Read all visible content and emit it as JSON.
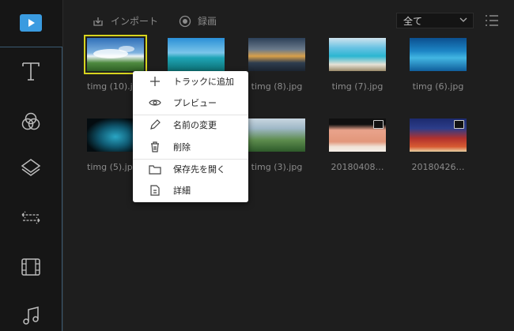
{
  "toolbar": {
    "import_label": "インポート",
    "record_label": "録画",
    "filter_value": "全て"
  },
  "sidebar": {
    "items": [
      {
        "icon": "media-icon"
      },
      {
        "icon": "text-icon"
      },
      {
        "icon": "filters-icon"
      },
      {
        "icon": "overlays-icon"
      },
      {
        "icon": "transitions-icon"
      },
      {
        "icon": "elements-icon"
      },
      {
        "icon": "music-icon"
      }
    ]
  },
  "media": {
    "row1": [
      {
        "label": "timg (10).jpg",
        "selected": true,
        "video": false
      },
      {
        "label": "",
        "selected": false,
        "video": false
      },
      {
        "label": "timg (8).jpg",
        "selected": false,
        "video": false
      },
      {
        "label": "timg (7).jpg",
        "selected": false,
        "video": false
      },
      {
        "label": "timg (6).jpg",
        "selected": false,
        "video": false
      }
    ],
    "row2": [
      {
        "label": "timg (5).jpg",
        "selected": false,
        "video": false
      },
      {
        "label": "",
        "selected": false,
        "video": false
      },
      {
        "label": "timg (3).jpg",
        "selected": false,
        "video": false
      },
      {
        "label": "20180408…",
        "selected": false,
        "video": true
      },
      {
        "label": "20180426…",
        "selected": false,
        "video": true
      }
    ]
  },
  "context_menu": {
    "items": [
      {
        "label": "トラックに追加",
        "icon": "plus-icon"
      },
      {
        "label": "プレビュー",
        "icon": "eye-icon"
      },
      {
        "label": "名前の変更",
        "icon": "pencil-icon"
      },
      {
        "label": "削除",
        "icon": "trash-icon"
      },
      {
        "label": "保存先を開く",
        "icon": "folder-icon"
      },
      {
        "label": "詳細",
        "icon": "details-icon"
      }
    ]
  },
  "colors": {
    "accent": "#3a9be0",
    "selection": "#d7d41f",
    "background": "#1e1e1e"
  }
}
